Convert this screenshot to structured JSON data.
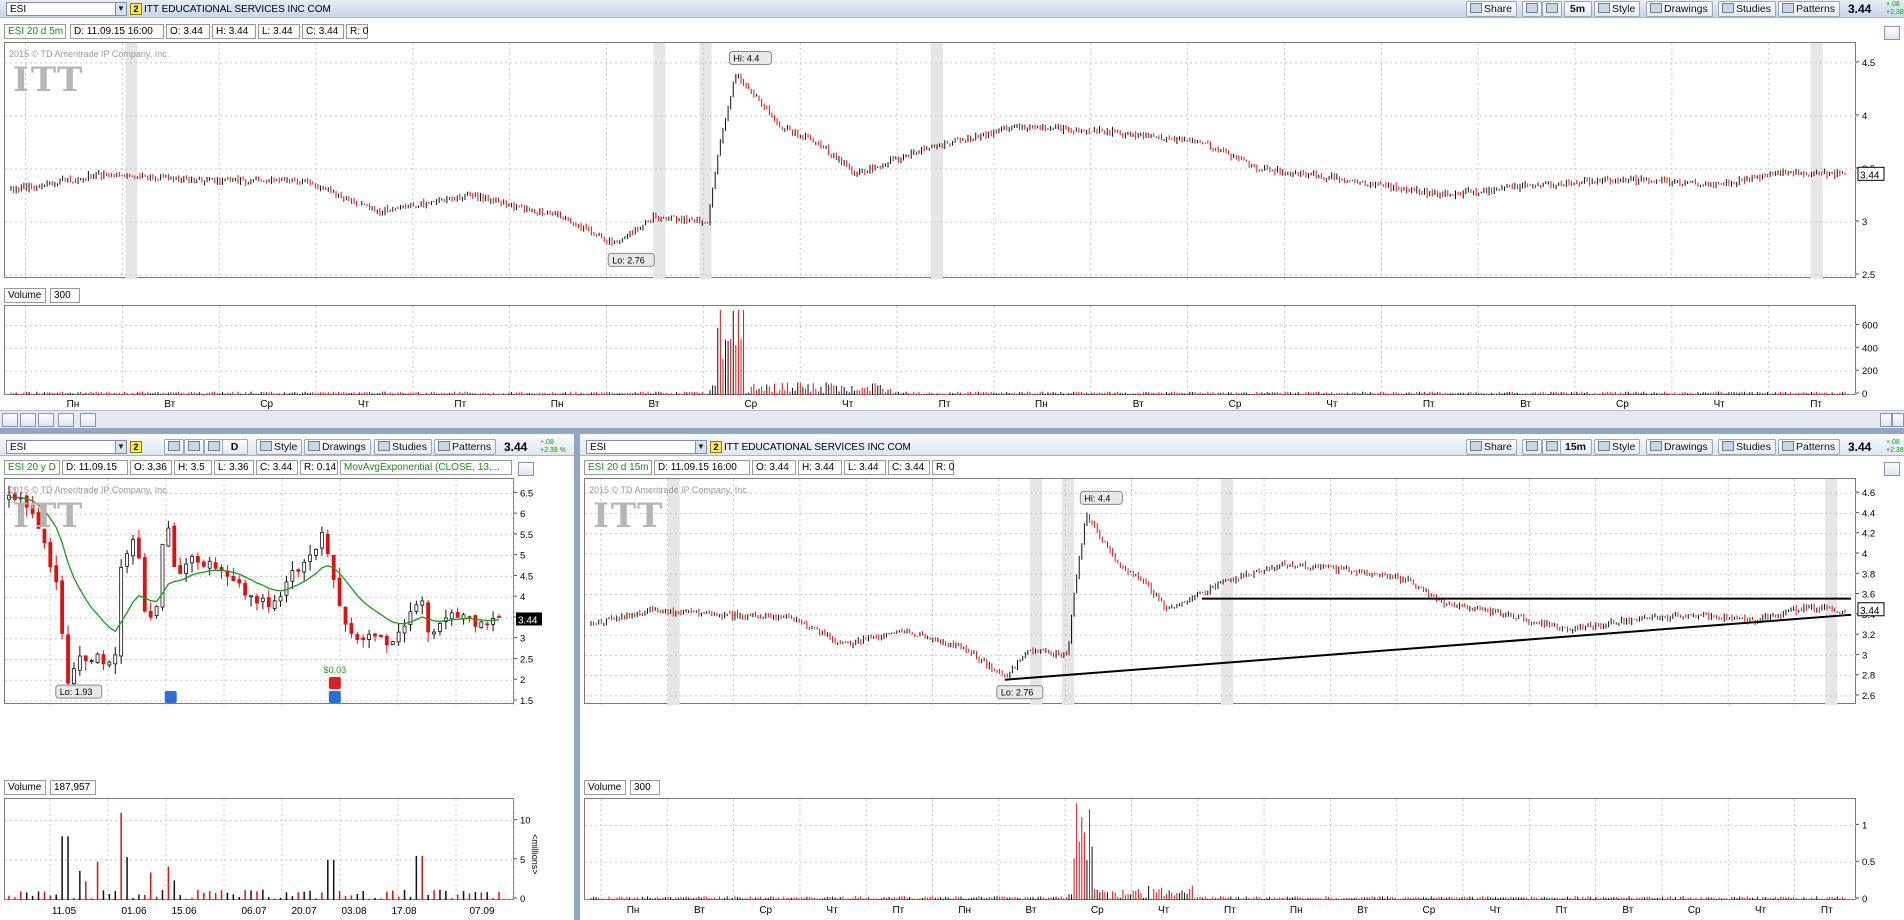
{
  "top": {
    "symbol": "ESI",
    "link_badge": "2",
    "company": "ITT EDUCATIONAL SERVICES INC COM",
    "buttons": {
      "share": "Share",
      "interval": "5m",
      "style": "Style",
      "drawings": "Drawings",
      "studies": "Studies",
      "patterns": "Patterns"
    },
    "last": "3.44",
    "change": "+.08",
    "change_pct": "+2.38",
    "info": {
      "desc": "ESI 20 d 5m",
      "d": "D: 11.09.15 16:00",
      "o": "O: 3.44",
      "h": "H: 3.44",
      "l": "L: 3.44",
      "c": "C: 3.44",
      "r": "R: 0"
    },
    "watermark": "2015 © TD Ameritrade IP Company, Inc.",
    "logo": "ITT",
    "price_ticks": [
      "4.5",
      "4",
      "3.5",
      "3",
      "2.5"
    ],
    "hi_label": "Hi: 4.4",
    "lo_label": "Lo: 2.76",
    "price_tag": "3.44",
    "volume_label": "Volume",
    "volume_value": "300",
    "volume_ticks": [
      "600",
      "400",
      "200",
      "0"
    ],
    "day_labels": [
      "Пн",
      "Вт",
      "Ср",
      "Чт",
      "Пт",
      "Пн",
      "Вт",
      "Ср",
      "Чт",
      "Пт",
      "Пн",
      "Вт",
      "Ср",
      "Чт",
      "Пт",
      "Вт",
      "Ср",
      "Чт",
      "Пт"
    ]
  },
  "left": {
    "symbol": "ESI",
    "link_badge": "2",
    "buttons": {
      "interval": "D",
      "style": "Style",
      "drawings": "Drawings",
      "studies": "Studies",
      "patterns": "Patterns"
    },
    "last": "3.44",
    "change": "+.08",
    "change_pct": "+2.38 %",
    "info": {
      "desc": "ESI 20 y D",
      "d": "D: 11.09.15",
      "o": "O: 3.36",
      "h": "H: 3.5",
      "l": "L: 3.36",
      "c": "C: 3.44",
      "r": "R: 0.14",
      "study": "MovAvgExponential (CLOSE, 13,..."
    },
    "watermark": "2015 © TD Ameritrade IP Company, Inc.",
    "logo": "ITT",
    "price_ticks": [
      "6.5",
      "6",
      "5.5",
      "5",
      "4.5",
      "4",
      "3.5",
      "3",
      "2.5",
      "2",
      "1.5"
    ],
    "lo_label": "Lo: 1.93",
    "dividend_label": "$0.03",
    "price_tag": "3.44",
    "volume_label": "Volume",
    "volume_value": "187,957",
    "volume_ticks": [
      "10",
      "5",
      "0"
    ],
    "volume_unit": "<millions>",
    "date_labels": [
      "11.05",
      "01.06",
      "15.06",
      "06.07",
      "20.07",
      "03.08",
      "17.08",
      "07.09"
    ]
  },
  "right": {
    "symbol": "ESI",
    "link_badge": "2",
    "company": "ITT EDUCATIONAL SERVICES INC COM",
    "buttons": {
      "share": "Share",
      "interval": "15m",
      "style": "Style",
      "drawings": "Drawings",
      "studies": "Studies",
      "patterns": "Patterns"
    },
    "last": "3.44",
    "change": "+.08",
    "change_pct": "+2.38",
    "info": {
      "desc": "ESI 20 d 15m",
      "d": "D: 11.09.15 16:00",
      "o": "O: 3.44",
      "h": "H: 3.44",
      "l": "L: 3.44",
      "c": "C: 3.44",
      "r": "R: 0"
    },
    "watermark": "2015 © TD Ameritrade IP Company, Inc.",
    "logo": "ITT",
    "price_ticks": [
      "4.6",
      "4.4",
      "4.2",
      "4",
      "3.8",
      "3.6",
      "3.4",
      "3.2",
      "3",
      "2.8",
      "2.6"
    ],
    "hi_label": "Hi: 4.4",
    "lo_label": "Lo: 2.76",
    "price_tag": "3.44",
    "volume_label": "Volume",
    "volume_value": "300",
    "volume_ticks": [
      "1",
      "0.5",
      "0"
    ],
    "day_labels": [
      "Пн",
      "Вт",
      "Ср",
      "Чт",
      "Пт",
      "Пн",
      "Вт",
      "Ср",
      "Чт",
      "Пт",
      "Пн",
      "Вт",
      "Ср",
      "Чт",
      "Пт",
      "Вт",
      "Ср",
      "Чт",
      "Пт"
    ]
  },
  "colors": {
    "up": "#111111",
    "down": "#e01010",
    "ema": "#1a9a1a",
    "grid": "#c8c8c8",
    "highlight": "#e6e6e6",
    "frame": "#7a7a7a"
  }
}
